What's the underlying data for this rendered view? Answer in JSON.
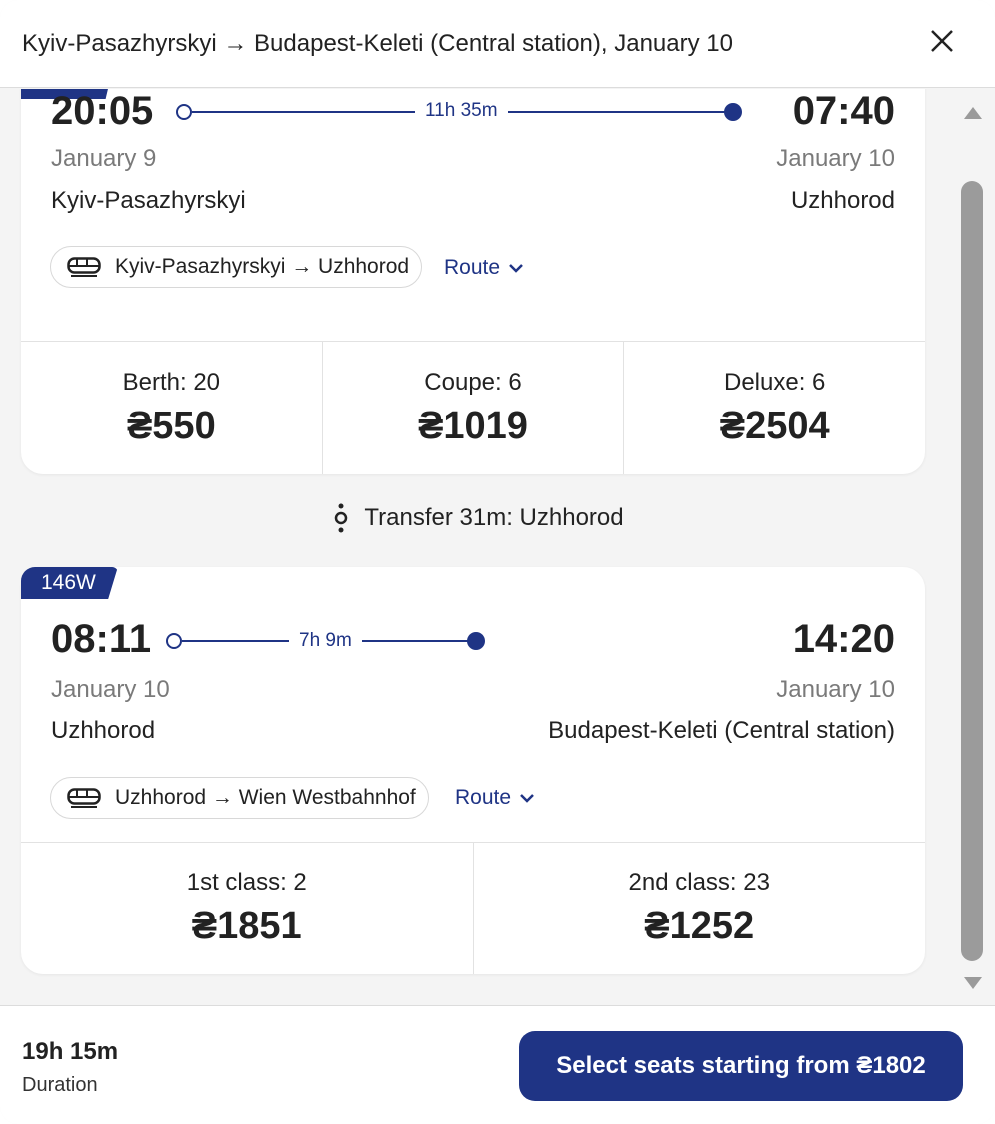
{
  "header": {
    "title": "Kyiv-Pasazhyrskyi → Budapest-Keleti (Central station), January 10"
  },
  "segments": [
    {
      "train_number": "",
      "departure": {
        "time": "20:05",
        "date": "January 9",
        "station": "Kyiv-Pasazhyrskyi"
      },
      "arrival": {
        "time": "07:40",
        "date": "January 10",
        "station": "Uzhhorod"
      },
      "duration": "11h 35m",
      "route_pill": "Kyiv-Pasazhyrskyi → Uzhhorod",
      "route_link": "Route",
      "fares": [
        {
          "name": "Berth: 20",
          "price": "₴550"
        },
        {
          "name": "Coupe: 6",
          "price": "₴1019"
        },
        {
          "name": "Deluxe: 6",
          "price": "₴2504"
        }
      ]
    },
    {
      "train_number": "146W",
      "departure": {
        "time": "08:11",
        "date": "January 10",
        "station": "Uzhhorod"
      },
      "arrival": {
        "time": "14:20",
        "date": "January 10",
        "station": "Budapest-Keleti (Central station)"
      },
      "duration": "7h 9m",
      "route_pill": "Uzhhorod → Wien Westbahnhof",
      "route_link": "Route",
      "fares": [
        {
          "name": "1st class: 2",
          "price": "₴1851"
        },
        {
          "name": "2nd class: 23",
          "price": "₴1252"
        }
      ]
    }
  ],
  "transfer": {
    "text": "Transfer 31m: Uzhhorod"
  },
  "footer": {
    "total_duration": "19h 15m",
    "duration_caption": "Duration",
    "select_button": "Select seats starting from ₴1802"
  },
  "colors": {
    "accent": "#1f3485",
    "muted_text": "#7a7a7a",
    "background": "#f4f4f4"
  },
  "icons": [
    "close-icon",
    "train-icon",
    "chevron-down-icon",
    "transfer-icon",
    "scroll-up-icon",
    "scroll-down-icon"
  ]
}
